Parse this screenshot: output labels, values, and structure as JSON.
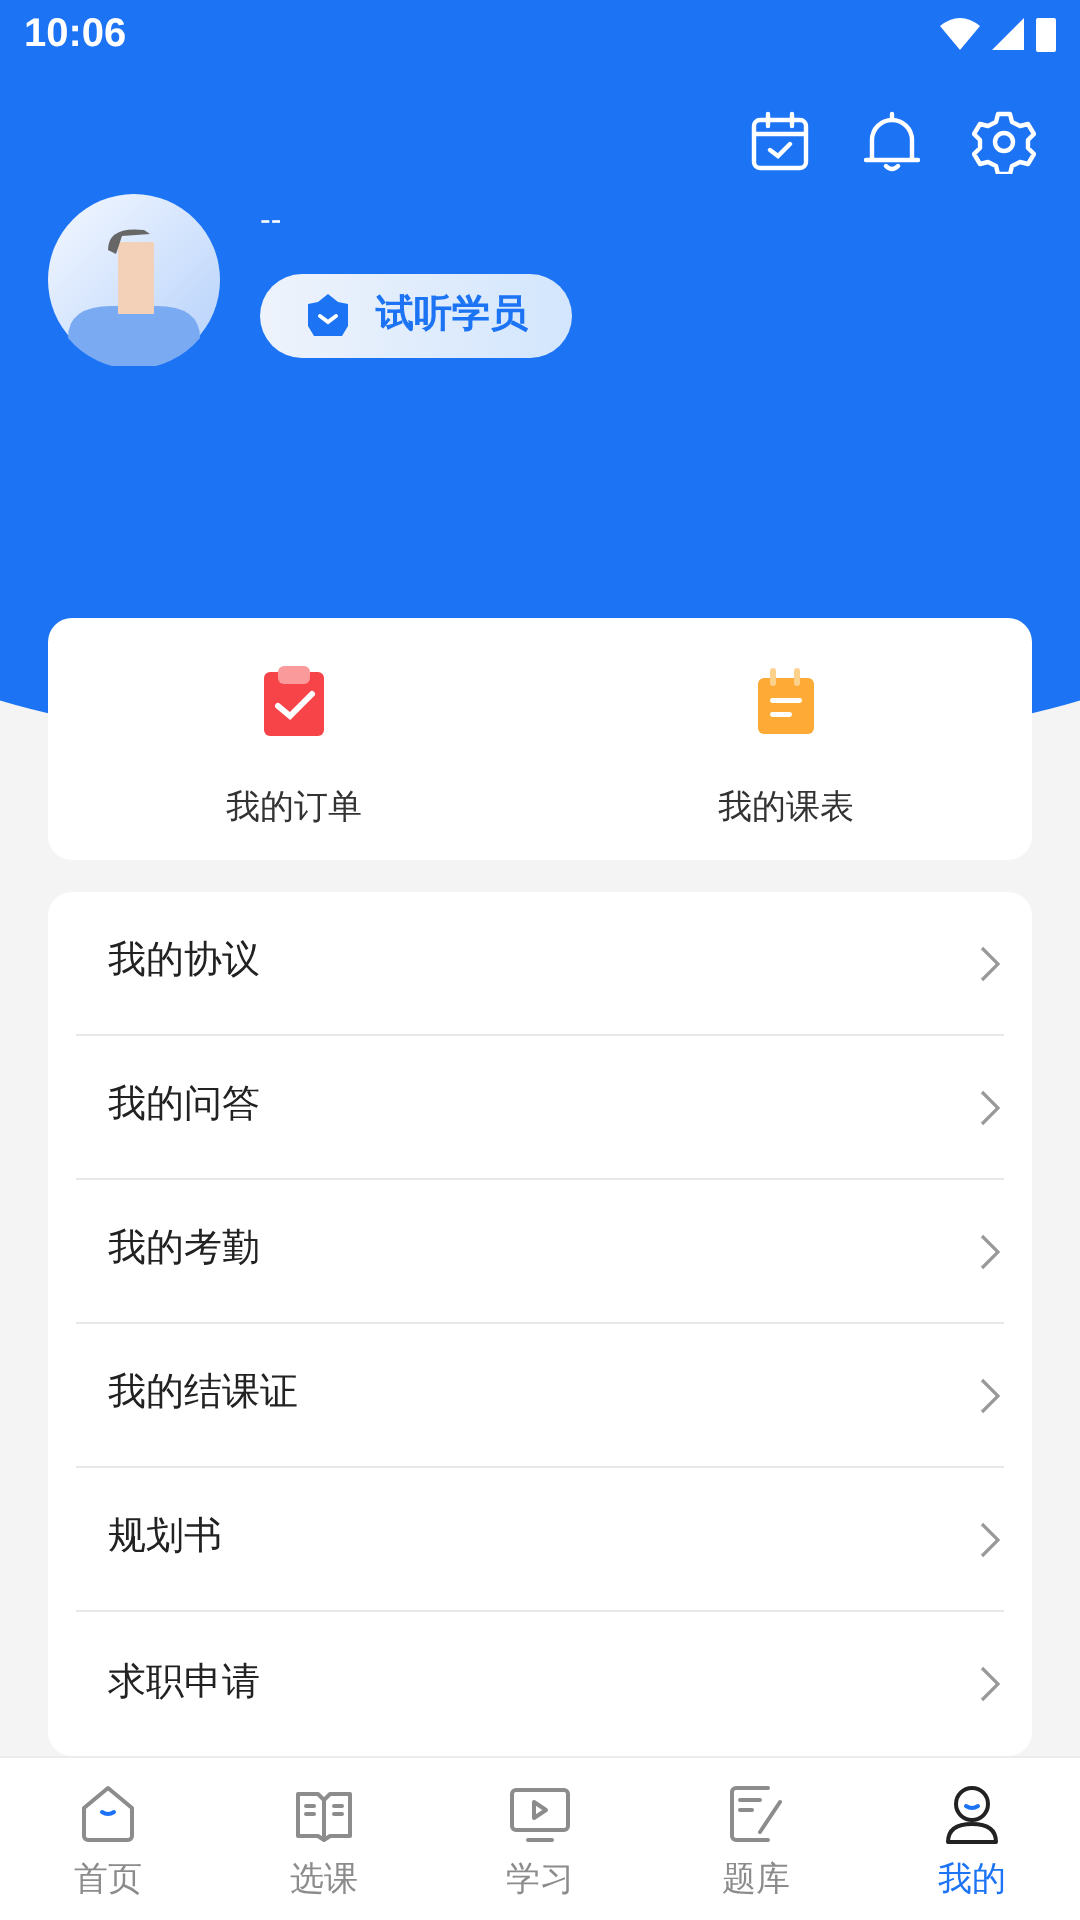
{
  "status_bar": {
    "time": "10:06"
  },
  "profile": {
    "name": "--",
    "badge": "试听学员"
  },
  "shortcuts": [
    {
      "label": "我的订单",
      "kind": "order"
    },
    {
      "label": "我的课表",
      "kind": "schedule"
    }
  ],
  "menu": [
    "我的协议",
    "我的问答",
    "我的考勤",
    "我的结课证",
    "规划书",
    "求职申请"
  ],
  "tabs": [
    {
      "label": "首页",
      "kind": "home",
      "selected": false
    },
    {
      "label": "选课",
      "kind": "book",
      "selected": false
    },
    {
      "label": "学习",
      "kind": "video",
      "selected": false
    },
    {
      "label": "题库",
      "kind": "note",
      "selected": false
    },
    {
      "label": "我的",
      "kind": "user",
      "selected": true
    }
  ]
}
